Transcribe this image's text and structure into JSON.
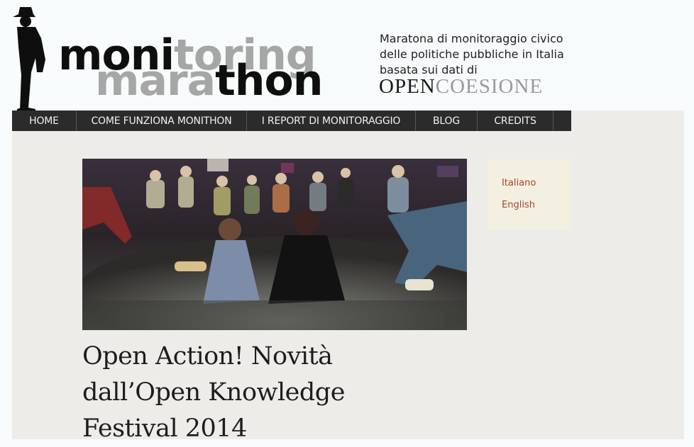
{
  "header": {
    "logo": {
      "line1_dark": "moni",
      "line1_gray": "toring",
      "line2_gray": "mara",
      "line2_dark": "thon"
    },
    "tagline": [
      "Maratona di monitoraggio civico",
      "delle politiche pubbliche in Italia",
      "basata sui dati di"
    ],
    "partner": {
      "part1": "OPEN",
      "part2": "COESIONE"
    }
  },
  "nav": {
    "items": [
      {
        "label": "HOME"
      },
      {
        "label": "COME FUNZIONA MONITHON"
      },
      {
        "label": "I REPORT DI MONITORAGGIO"
      },
      {
        "label": "BLOG"
      },
      {
        "label": "CREDITS"
      }
    ]
  },
  "article": {
    "title": "Open Action! Novità dall’Open Knowledge Festival 2014"
  },
  "languages": [
    {
      "label": "Italiano"
    },
    {
      "label": "English"
    }
  ],
  "colors": {
    "nav_bg": "#2b2b2b",
    "content_bg": "#eeece9",
    "link": "#a2452c",
    "lang_box_bg": "#f3f0e2"
  }
}
